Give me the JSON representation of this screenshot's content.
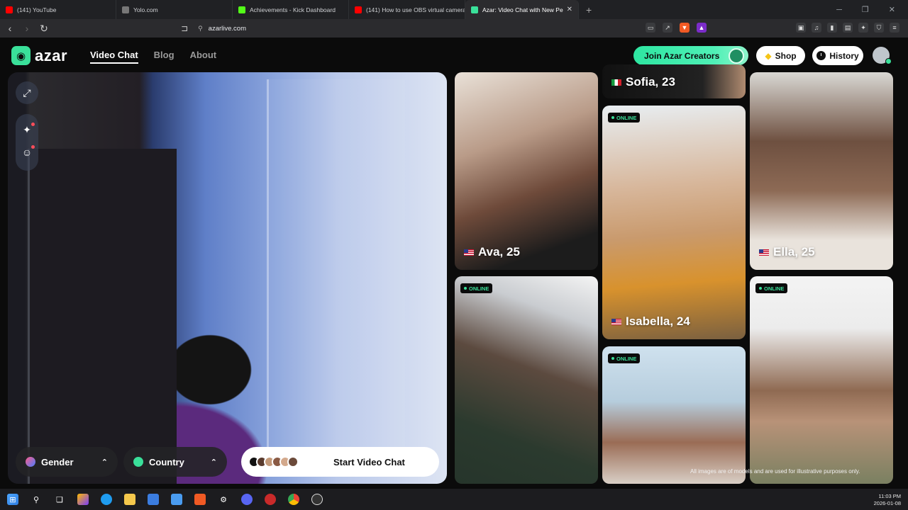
{
  "browser": {
    "tabs": [
      {
        "label": "(141) YouTube",
        "color": "#ff0000"
      },
      {
        "label": "Yolo.com",
        "color": "#3a3b3e"
      },
      {
        "label": "Achievements - Kick Dashboard",
        "color": "#53fc18"
      },
      {
        "label": "(141) How to use OBS virtual camera",
        "color": "#ff0000"
      },
      {
        "label": "Azar: Video Chat with New Pe",
        "color": "#3ae09a"
      }
    ],
    "new_tab_glyph": "+",
    "url": "azarlive.com"
  },
  "site": {
    "logo_text": "azar",
    "nav": [
      {
        "label": "Video Chat",
        "active": true
      },
      {
        "label": "Blog",
        "active": false
      },
      {
        "label": "About",
        "active": false
      }
    ],
    "creators_label": "Join Azar Creators",
    "shop_label": "Shop",
    "history_label": "History",
    "accent_color": "#3ae09a"
  },
  "camera": {
    "gender_label": "Gender",
    "country_label": "Country",
    "start_label": "Start Video Chat",
    "icons": [
      "expand-icon",
      "sparkle-icon",
      "sticker-icon"
    ]
  },
  "gallery": {
    "cards": [
      {
        "name": "Sofia, 23",
        "flag": "it",
        "online": false
      },
      {
        "name": "Ava, 25",
        "flag": "us",
        "online": false
      },
      {
        "name": "Isabella, 24",
        "flag": "us",
        "online": true
      },
      {
        "name": "Ella, 25",
        "flag": "us",
        "online": false
      },
      {
        "name": "",
        "flag": "",
        "online": true
      },
      {
        "name": "",
        "flag": "",
        "online": true
      },
      {
        "name": "",
        "flag": "",
        "online": true
      }
    ],
    "online_label": "ONLINE",
    "disclaimer": "All images are of models and are used for illustrative purposes only."
  },
  "taskbar": {
    "time": "11:03 PM",
    "date": "2026-01-08"
  }
}
